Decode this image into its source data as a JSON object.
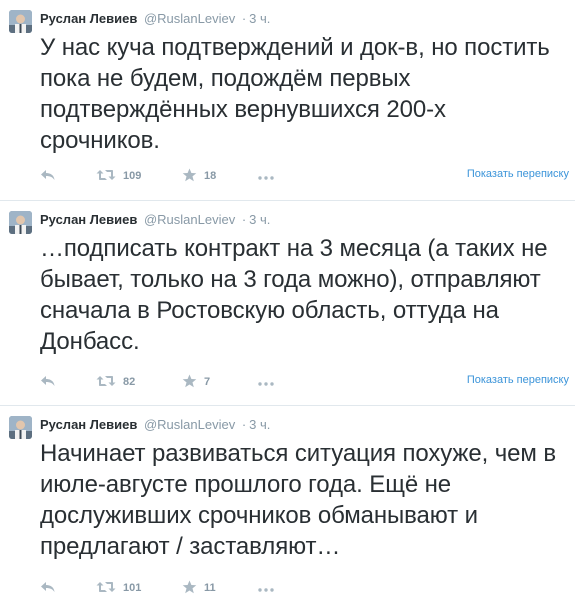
{
  "tweets": [
    {
      "fullname": "Руслан Левиев",
      "username": "@RuslanLeviev",
      "separator": "·",
      "time": "3 ч.",
      "text": "У нас куча подтверждений и док-в, но постить пока не будем, подождём первых подтверждённых вернувшихся 200-х срочников.",
      "retweets": "109",
      "favorites": "18",
      "conversation_link": "Показать переписку"
    },
    {
      "fullname": "Руслан Левиев",
      "username": "@RuslanLeviev",
      "separator": "·",
      "time": "3 ч.",
      "text": "…подписать контракт на 3 месяца (а таких не бывает, только на 3 года можно), отправляют сначала в Ростовскую область, оттуда на Донбасс.",
      "retweets": "82",
      "favorites": "7",
      "conversation_link": "Показать переписку"
    },
    {
      "fullname": "Руслан Левиев",
      "username": "@RuslanLeviev",
      "separator": "·",
      "time": "3 ч.",
      "text": "Начинает развиваться ситуация похуже, чем в июле-августе прошлого года. Ещё не дослуживших срочников обманывают и предлагают / заставляют…",
      "retweets": "101",
      "favorites": "11"
    }
  ],
  "icons": {
    "reply": "reply-icon",
    "retweet": "retweet-icon",
    "favorite": "star-icon",
    "more": "more-icon"
  },
  "colors": {
    "text": "#292f33",
    "muted": "#8899a6",
    "link": "#3b94d9",
    "divider": "#e1e8ed"
  }
}
